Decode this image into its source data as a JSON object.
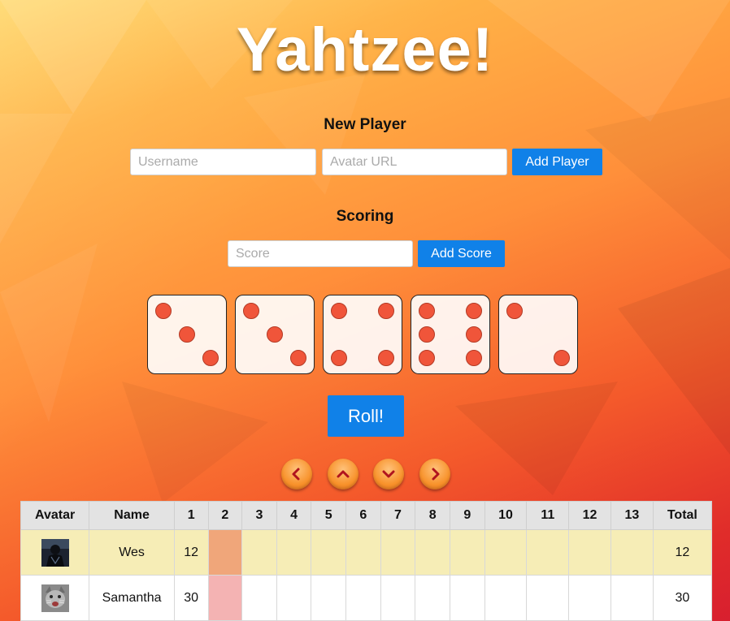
{
  "title": "Yahtzee!",
  "new_player": {
    "heading": "New Player",
    "username_placeholder": "Username",
    "avatar_placeholder": "Avatar URL",
    "add_label": "Add Player"
  },
  "scoring": {
    "heading": "Scoring",
    "score_placeholder": "Score",
    "add_label": "Add Score"
  },
  "dice": [
    3,
    3,
    4,
    6,
    2
  ],
  "roll_label": "Roll!",
  "nav_icons": [
    "chevron-left-icon",
    "chevron-up-icon",
    "chevron-down-icon",
    "chevron-right-icon"
  ],
  "table": {
    "headers": [
      "Avatar",
      "Name",
      "1",
      "2",
      "3",
      "4",
      "5",
      "6",
      "7",
      "8",
      "9",
      "10",
      "11",
      "12",
      "13",
      "Total"
    ],
    "players": [
      {
        "name": "Wes",
        "scores": [
          "12",
          "",
          "",
          "",
          "",
          "",
          "",
          "",
          "",
          "",
          "",
          "",
          ""
        ],
        "total": "12"
      },
      {
        "name": "Samantha",
        "scores": [
          "30",
          "",
          "",
          "",
          "",
          "",
          "",
          "",
          "",
          "",
          "",
          "",
          ""
        ],
        "total": "30"
      }
    ]
  },
  "colors": {
    "accent": "#1081e8",
    "pip": "#f0553a",
    "active_row": "#f6edb6",
    "current_cell_p1": "#f0a67a",
    "current_cell_p2": "#f4b3b3"
  }
}
